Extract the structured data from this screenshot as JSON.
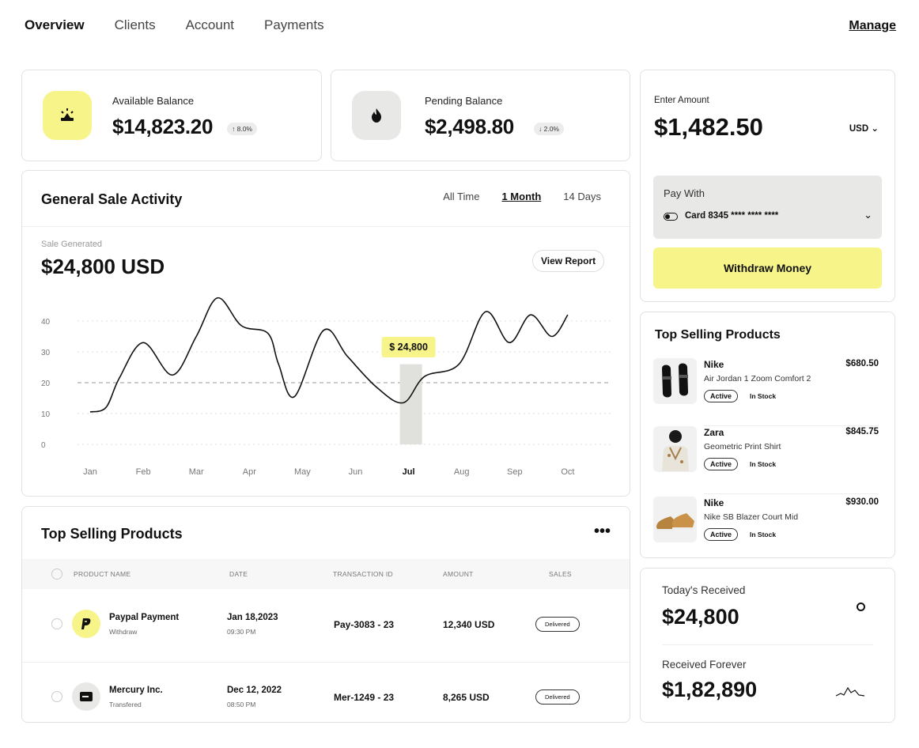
{
  "nav": {
    "tabs": [
      "Overview",
      "Clients",
      "Account",
      "Payments"
    ],
    "active": "Overview",
    "manage_label": "Manage"
  },
  "balances": {
    "available": {
      "label": "Available Balance",
      "value": "$14,823.20",
      "badge": "↑ 8.0%",
      "icon": "bolt-sun-icon",
      "icon_bg": "#f7f58a"
    },
    "pending": {
      "label": "Pending Balance",
      "value": "$2,498.80",
      "badge": "↓ 2.0%",
      "icon": "flame-icon",
      "icon_bg": "#e8e8e6"
    }
  },
  "sale_activity": {
    "title": "General Sale Activity",
    "ranges": [
      "All Time",
      "1 Month",
      "14 Days"
    ],
    "active_range": "1 Month",
    "sale_label": "Sale Generated",
    "sale_value": "$24,800 USD",
    "view_report_label": "View Report",
    "tooltip": "$ 24,800"
  },
  "chart_data": {
    "type": "line",
    "categories": [
      "Jan",
      "Feb",
      "Mar",
      "Apr",
      "May",
      "Jun",
      "Jul",
      "Aug",
      "Sep",
      "Oct"
    ],
    "highlight": "Jul",
    "x": [
      0,
      0.3,
      0.55,
      1.0,
      1.55,
      2.0,
      2.4,
      2.85,
      3.35,
      3.55,
      3.85,
      4.4,
      4.85,
      5.4,
      5.9,
      6.3,
      6.95,
      7.45,
      7.9,
      8.3,
      8.7,
      9.0
    ],
    "y": [
      10.5,
      12,
      21.5,
      33,
      22.5,
      35,
      47.5,
      38.5,
      36,
      26,
      15.5,
      37,
      28.5,
      18.5,
      13.5,
      22,
      26,
      43,
      33,
      42,
      35,
      42
    ],
    "yticks": [
      0,
      10,
      20,
      30,
      40
    ],
    "ylim": [
      0,
      40
    ],
    "reference_line": 20,
    "grid": true,
    "line_color": "#111111",
    "bar_color": "#e0e0dc",
    "tooltip_color": "#f7f58a"
  },
  "products_table": {
    "title": "Top Selling Products",
    "menu_icon": "more-horizontal-icon",
    "columns": [
      "PRODUCT NAME",
      "DATE",
      "TRANSACTION ID",
      "AMOUNT",
      "SALES"
    ],
    "rows": [
      {
        "name": "Paypal Payment",
        "sub": "Withdraw",
        "date": "Jan 18,2023",
        "time": "09:30 PM",
        "tx": "Pay-3083 - 23",
        "amount": "12,340 USD",
        "status": "Delivered",
        "icon": "paypal-icon",
        "icon_bg": "#f7f58a"
      },
      {
        "name": "Mercury Inc.",
        "sub": "Transfered",
        "date": "Dec 12, 2022",
        "time": "08:50 PM",
        "tx": "Mer-1249 - 23",
        "amount": "8,265 USD",
        "status": "Delivered",
        "icon": "card-icon",
        "icon_bg": "#e8e8e6"
      }
    ]
  },
  "withdraw": {
    "enter_label": "Enter Amount",
    "amount": "$1,482.50",
    "currency": "USD",
    "pay_with_label": "Pay With",
    "card": "Card 8345 **** **** ****",
    "button": "Withdraw Money",
    "accent": "#f7f58a"
  },
  "top_selling": {
    "title": "Top Selling Products",
    "items": [
      {
        "brand": "Nike",
        "name": "Air Jordan 1 Zoom Comfort 2",
        "price": "$680.50",
        "status": "Active",
        "stock": "In Stock",
        "image": "sandals-image"
      },
      {
        "brand": "Zara",
        "name": "Geometric Print Shirt",
        "price": "$845.75",
        "status": "Active",
        "stock": "In Stock",
        "image": "shirt-model-image"
      },
      {
        "brand": "Nike",
        "name": "Nike SB Blazer Court Mid",
        "price": "$930.00",
        "status": "Active",
        "stock": "In Stock",
        "image": "sneakers-image"
      }
    ]
  },
  "received": {
    "today_label": "Today's Received",
    "today_value": "$24,800",
    "today_icon": "circle-icon",
    "forever_label": "Received Forever",
    "forever_value": "$1,82,890",
    "forever_icon": "sparkline-icon"
  }
}
